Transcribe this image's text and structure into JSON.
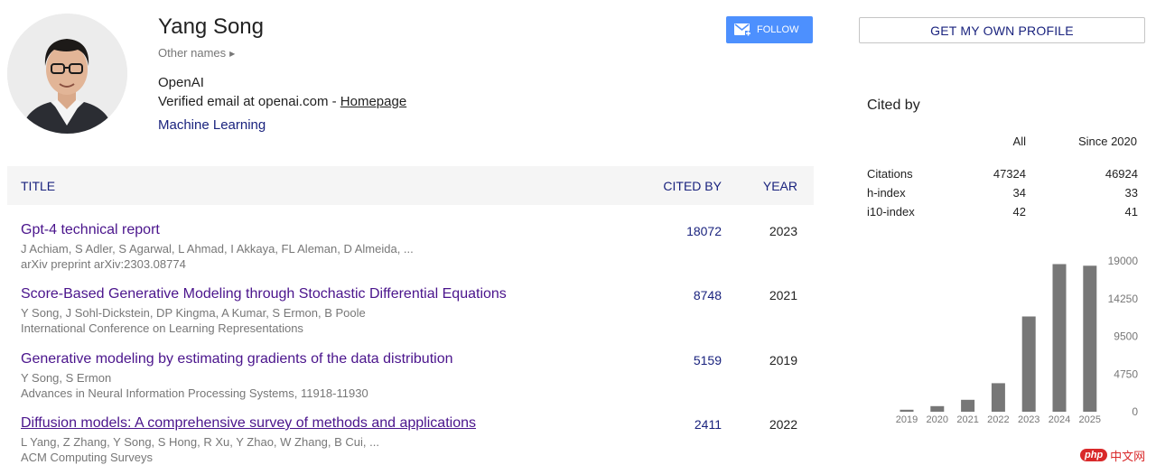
{
  "profile": {
    "name": "Yang Song",
    "other_names": "Other names",
    "affiliation": "OpenAI",
    "email_prefix": "Verified email at openai.com - ",
    "homepage": "Homepage",
    "interest": "Machine Learning"
  },
  "buttons": {
    "follow": "FOLLOW",
    "get_profile": "GET MY OWN PROFILE"
  },
  "table": {
    "headers": {
      "title": "TITLE",
      "cited_by": "CITED BY",
      "year": "YEAR"
    },
    "rows": [
      {
        "title": "Gpt-4 technical report",
        "authors": "J Achiam, S Adler, S Agarwal, L Ahmad, I Akkaya, FL Aleman, D Almeida, ...",
        "venue": "arXiv preprint arXiv:2303.08774",
        "cited_by": "18072",
        "year": "2023"
      },
      {
        "title": "Score-Based Generative Modeling through Stochastic Differential Equations",
        "authors": "Y Song, J Sohl-Dickstein, DP Kingma, A Kumar, S Ermon, B Poole",
        "venue": "International Conference on Learning Representations",
        "cited_by": "8748",
        "year": "2021"
      },
      {
        "title": "Generative modeling by estimating gradients of the data distribution",
        "authors": "Y Song, S Ermon",
        "venue": "Advances in Neural Information Processing Systems, 11918-11930",
        "cited_by": "5159",
        "year": "2019"
      },
      {
        "title": "Diffusion models: A comprehensive survey of methods and applications",
        "authors": "L Yang, Z Zhang, Y Song, S Hong, R Xu, Y Zhao, W Zhang, B Cui, ...",
        "venue": "ACM Computing Surveys",
        "cited_by": "2411",
        "year": "2022"
      }
    ]
  },
  "cited_by": {
    "title": "Cited by",
    "col_all": "All",
    "col_since": "Since 2020",
    "rows": [
      {
        "label": "Citations",
        "all": "47324",
        "since": "46924"
      },
      {
        "label": "h-index",
        "all": "34",
        "since": "33"
      },
      {
        "label": "i10-index",
        "all": "42",
        "since": "41"
      }
    ]
  },
  "chart_data": {
    "type": "bar",
    "categories": [
      "2019",
      "2020",
      "2021",
      "2022",
      "2023",
      "2024",
      "2025"
    ],
    "values": [
      250,
      700,
      1500,
      3600,
      12000,
      18600,
      18400
    ],
    "yticks": [
      "0",
      "4750",
      "9500",
      "14250",
      "19000"
    ],
    "ylim": [
      0,
      19000
    ],
    "bar_color": "#777777"
  },
  "watermark": {
    "php": "php",
    "cn": "中文网"
  },
  "colors": {
    "accent_button": "#4d90fe",
    "link": "#4a148c",
    "header_text": "#1a237e"
  }
}
